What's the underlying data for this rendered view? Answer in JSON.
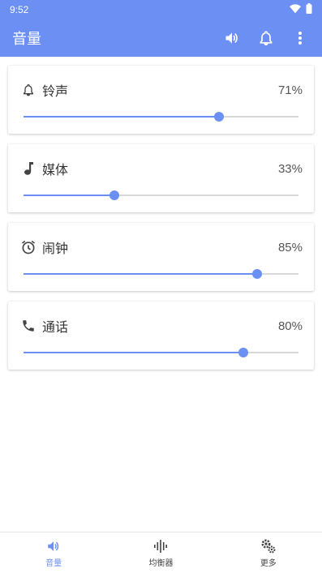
{
  "status_bar": {
    "time": "9:52"
  },
  "app_bar": {
    "title": "音量",
    "actions": [
      "volume-up-icon",
      "bell-icon",
      "more-vert-icon"
    ]
  },
  "colors": {
    "primary": "#6b8ff2",
    "track": "#d8d8d8"
  },
  "volumes": [
    {
      "id": "ringtone",
      "label": "铃声",
      "value": "71%",
      "level": 0.71,
      "icon": "bell-outline-icon"
    },
    {
      "id": "media",
      "label": "媒体",
      "value": "33%",
      "level": 0.33,
      "icon": "music-note-icon"
    },
    {
      "id": "alarm",
      "label": "闹钟",
      "value": "85%",
      "level": 0.85,
      "icon": "alarm-clock-icon"
    },
    {
      "id": "call",
      "label": "通话",
      "value": "80%",
      "level": 0.8,
      "icon": "phone-icon"
    }
  ],
  "bottom_nav": {
    "items": [
      {
        "label": "音量",
        "icon": "volume-icon",
        "active": true
      },
      {
        "label": "均衡器",
        "icon": "equalizer-icon",
        "active": false
      },
      {
        "label": "更多",
        "icon": "gears-icon",
        "active": false
      }
    ]
  }
}
